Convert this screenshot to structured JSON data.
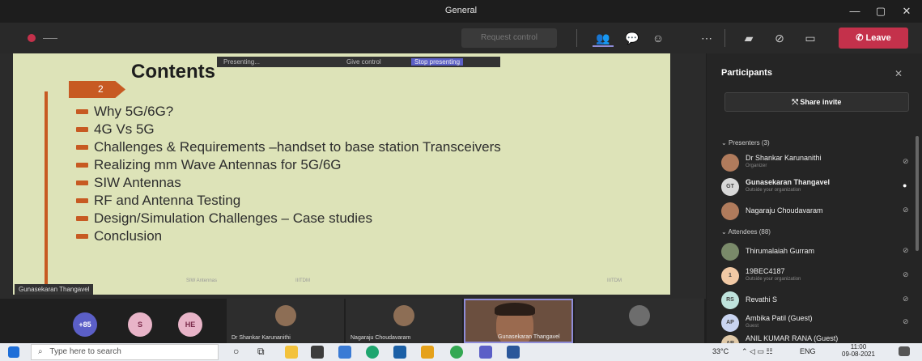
{
  "window": {
    "title": "General",
    "minimize": "—",
    "maximize": "▢",
    "close": "✕"
  },
  "toolbar": {
    "request_control": "Request control",
    "leave_label": "Leave"
  },
  "share_bar": {
    "presenting": "Presenting...",
    "control": "Give control",
    "stop": "Stop presenting"
  },
  "slide": {
    "number": "2",
    "title": "Contents",
    "bullets": [
      "Why 5G/6G?",
      "4G Vs 5G",
      "Challenges & Requirements –handset to base station Transceivers",
      "Realizing mm Wave Antennas for 5G/6G",
      "SIW Antennas",
      "RF and Antenna Testing",
      "Design/Simulation Challenges – Case studies",
      "Conclusion"
    ],
    "footer_left": "SIW Antennas",
    "footer_mid": "IIITDM",
    "footer_right": "IIITDM"
  },
  "presenter_label": "Gunasekaran Thangavel",
  "strip": {
    "count": "+85",
    "avatar1": "S",
    "avatar2": "HE",
    "tile1_name": "Dr Shankar Karunanithi",
    "tile2_name": "Nagaraju Choudavaram",
    "tile3_name": "Gunasekaran Thangavel"
  },
  "panel": {
    "title": "Participants",
    "share_invite": "Share invite",
    "presenters_header": "Presenters (3)",
    "attendees_header": "Attendees (88)",
    "presenters": [
      {
        "initials": "",
        "name": "Dr Shankar Karunanithi",
        "sub": "Organizer"
      },
      {
        "initials": "GT",
        "name": "Gunasekaran Thangavel",
        "sub": "Outside your organization"
      },
      {
        "initials": "",
        "name": "Nagaraju Choudavaram",
        "sub": ""
      }
    ],
    "attendees": [
      {
        "initials": "",
        "name": "Thirumalaiah Gurram",
        "sub": ""
      },
      {
        "initials": "1",
        "name": "19BEC4187",
        "sub": "Outside your organization"
      },
      {
        "initials": "RS",
        "name": "Revathi S",
        "sub": ""
      },
      {
        "initials": "AP",
        "name": "Ambika Patil (Guest)",
        "sub": "Guest"
      },
      {
        "initials": "AR",
        "name": "ANIL KUMAR RANA (Guest)",
        "sub": ""
      }
    ]
  },
  "taskbar": {
    "search_placeholder": "Type here to search",
    "temp": "33°C",
    "lang": "ENG",
    "time": "11:00",
    "date": "09-08-2021"
  }
}
